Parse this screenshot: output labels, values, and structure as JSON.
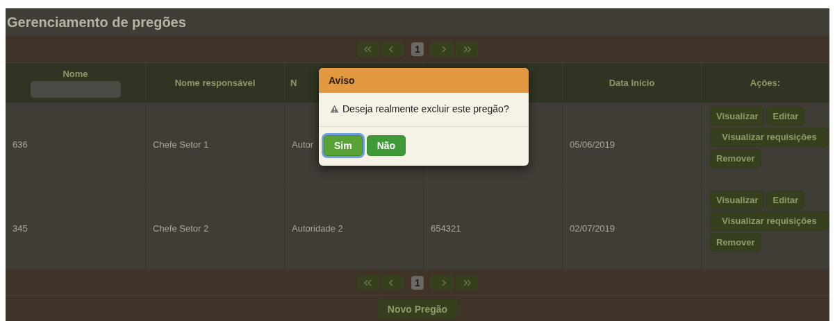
{
  "title": "Gerenciamento de pregões",
  "pager_top": {
    "pages": [
      {
        "label": "1",
        "selected": true
      }
    ]
  },
  "table": {
    "columns": [
      {
        "label": "Nome",
        "kind": "filter"
      },
      {
        "label": "Nome responsável",
        "kind": "text"
      },
      {
        "label": "N",
        "kind": "cut"
      },
      {
        "kind": "text"
      },
      {
        "label": "Data Início",
        "kind": "text"
      },
      {
        "label": "Ações:",
        "kind": "text"
      }
    ],
    "rows": [
      {
        "cells": [
          "636",
          "Chefe Setor 1",
          "Autor",
          null,
          "05/06/2019"
        ],
        "actions": [
          "Visualizar",
          "Editar",
          "Visualizar requisições",
          "Remover"
        ]
      },
      {
        "cells": [
          "345",
          "Chefe Setor 2",
          "Autoridade 2",
          "654321",
          "02/07/2019"
        ],
        "actions": [
          "Visualizar",
          "Editar",
          "Visualizar requisições",
          "Remover"
        ]
      }
    ]
  },
  "pager_bottom": {
    "pages": [
      {
        "label": "1",
        "selected": true
      }
    ]
  },
  "new_button": "Novo Pregão",
  "dialog": {
    "title": "Aviso",
    "message": "Deseja realmente excluir este pregão?",
    "buttons": [
      {
        "label": "Sim",
        "focused": true
      },
      {
        "label": "Não",
        "focused": false
      }
    ]
  }
}
